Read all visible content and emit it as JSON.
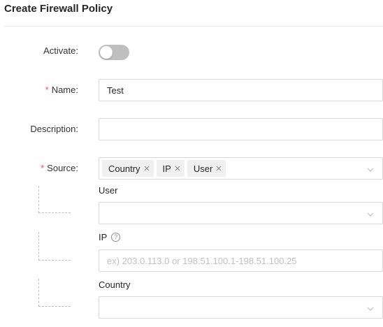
{
  "page": {
    "title": "Create Firewall Policy"
  },
  "form": {
    "activate": {
      "label": "Activate",
      "colon": ":",
      "enabled": false
    },
    "name": {
      "label": "Name",
      "colon": ":",
      "required_mark": "*",
      "value": "Test"
    },
    "description": {
      "label": "Description",
      "colon": ":",
      "value": ""
    },
    "source": {
      "label": "Source",
      "colon": ":",
      "required_mark": "*",
      "tags": [
        "Country",
        "IP",
        "User"
      ]
    },
    "user": {
      "label": "User",
      "value": ""
    },
    "ip": {
      "label": "IP",
      "help_glyph": "?",
      "placeholder": "ex) 203.0.113.0 or 198.51.100.1-198.51.100.25"
    },
    "country": {
      "label": "Country",
      "value": ""
    }
  },
  "icons": {
    "close": "close-icon",
    "dropdown": "chevron-down-icon",
    "help": "question-circle-icon"
  },
  "colors": {
    "required": "#ff4d4f",
    "toggle_off": "#bfbfbf",
    "tag_bg": "#f0f0f0",
    "border": "#d9d9d9"
  }
}
